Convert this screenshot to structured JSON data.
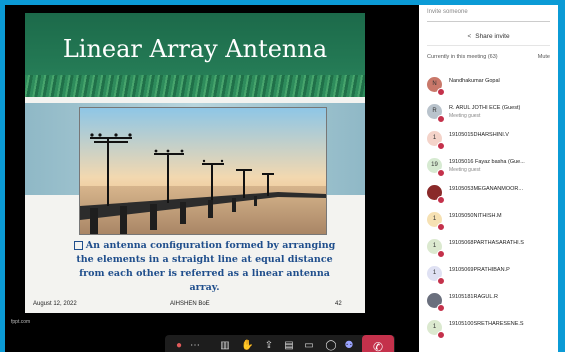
{
  "slide": {
    "title": "Linear Array Antenna",
    "caption": "An antenna configuration formed by arranging the elements in a straight line at equal distance from each other is referred as a linear antenna array.",
    "footer_date": "August 12, 2022",
    "footer_author": "AIHSHEN BoE",
    "footer_page": "42",
    "source": "fppt.com"
  },
  "panel": {
    "invite_placeholder": "Invite someone",
    "share_invite": "Share invite",
    "section_label": "Currently in this meeting (63)",
    "more_label": "Mute",
    "participants": [
      {
        "name": "Nandhakumar Gopal",
        "sub": "",
        "initial": "N",
        "color": "#c9786a"
      },
      {
        "name": "R. ARUL JOTHI ECE (Guest)",
        "sub": "Meeting guest",
        "initial": "R",
        "color": "#b9c3cc"
      },
      {
        "name": "19105015DHARSHINI.V",
        "sub": "",
        "initial": "1",
        "color": "#f4d3c9"
      },
      {
        "name": "19105016 Fayaz basha (Gue...",
        "sub": "Meeting guest",
        "initial": "19",
        "color": "#d6ead1"
      },
      {
        "name": "19105053MEGANANMOOR...",
        "sub": "",
        "initial": "",
        "color": "#8a2a2a"
      },
      {
        "name": "19105050NITHISH.M",
        "sub": "",
        "initial": "1",
        "color": "#f6e1b3"
      },
      {
        "name": "19105068PARTHASARATHI.S",
        "sub": "",
        "initial": "1",
        "color": "#dbe9cf"
      },
      {
        "name": "19105069PRATHIBAN.P",
        "sub": "",
        "initial": "1",
        "color": "#dfe1f3"
      },
      {
        "name": "19105181RAGUL.R",
        "sub": "",
        "initial": "",
        "color": "#6a6f7d"
      },
      {
        "name": "19105100SRETHARESENE.S",
        "sub": "",
        "initial": "1",
        "color": "#dbe9cf"
      }
    ]
  }
}
